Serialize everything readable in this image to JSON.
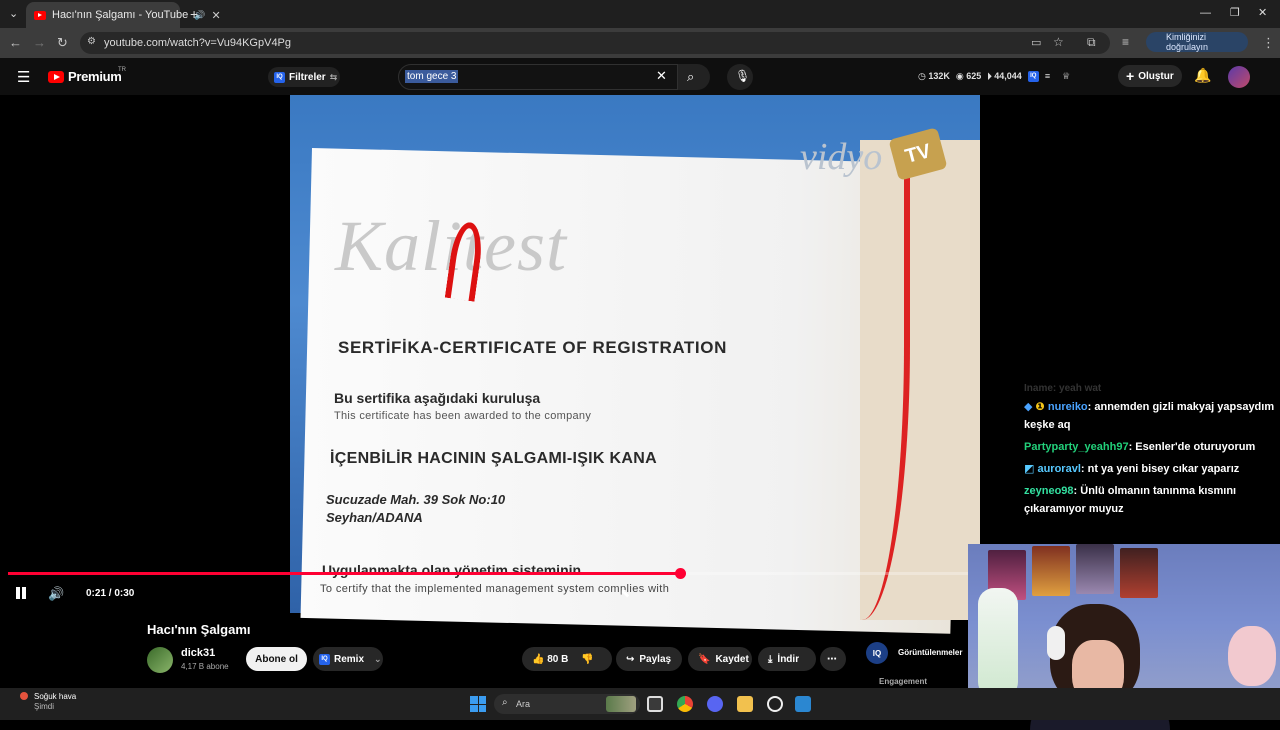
{
  "browser": {
    "tab_title": "Hacı'nın Şalgamı - YouTube",
    "new_tab": "+",
    "url": "youtube.com/watch?v=Vu94KGpV4Pg",
    "identity_label": "Kimliğinizi doğrulayın"
  },
  "youtube_header": {
    "logo_text": "Premium",
    "logo_region": "TR",
    "filters_label": "Filtreler",
    "search_value": "tom gece 3",
    "stats": [
      "132K",
      "625",
      "44,044"
    ],
    "create_label": "Oluştur"
  },
  "video": {
    "certificate": {
      "brand": "Kalitest",
      "heading": "SERTİFİKA-CERTIFICATE OF REGISTRATION",
      "line_tr": "Bu sertifika aşağıdaki kuruluşa",
      "line_en": "This certificate has been awarded to the company",
      "company": "İÇENBİLİR HACININ ŞALGAMI-IŞIK KANA",
      "address_1": "Sucuzade Mah. 39 Sok No:10",
      "address_2": "Seyhan/ADANA",
      "footer_tr": "Uygulanmakta olan yönetim sisteminin",
      "footer_en": "To certify that the implemented management system complies with",
      "watermark": "vidyo",
      "watermark_tv": "TV"
    },
    "progress": 0.7,
    "time": "0:21 / 0:30"
  },
  "chat": {
    "faded_line": "Iname: yeah wat",
    "messages": [
      {
        "user": "nureiko",
        "text": ": annemden gizli makyaj yapsaydım keşke aq"
      },
      {
        "user": "Partyparty_yeahh97",
        "text": ": Esenler'de oturuyorum"
      },
      {
        "user": "auroravl",
        "text": ": nt ya yeni bisey cıkar yaparız"
      },
      {
        "user": "zeyneo98",
        "text": ": Ünlü olmanın tanınma kısmını çıkaramıyor muyuz"
      }
    ]
  },
  "below_video": {
    "title": "Hacı'nın Şalgamı",
    "channel": "dick31",
    "subscribers": "4,17 B abone",
    "subscribe_label": "Abone ol",
    "remix_label": "Remix",
    "likes": "80 B",
    "share_label": "Paylaş",
    "save_label": "Kaydet",
    "download_label": "İndir",
    "engagement_title": "Görüntülenmeler",
    "engagement_sub": "Engagement"
  },
  "taskbar": {
    "weather_title": "Soğuk hava",
    "weather_sub": "Şimdi",
    "search_placeholder": "Ara"
  },
  "colors": {
    "yt_red": "#ff0000",
    "progress_red": "#ff0033",
    "iq_blue": "#2563eb"
  }
}
